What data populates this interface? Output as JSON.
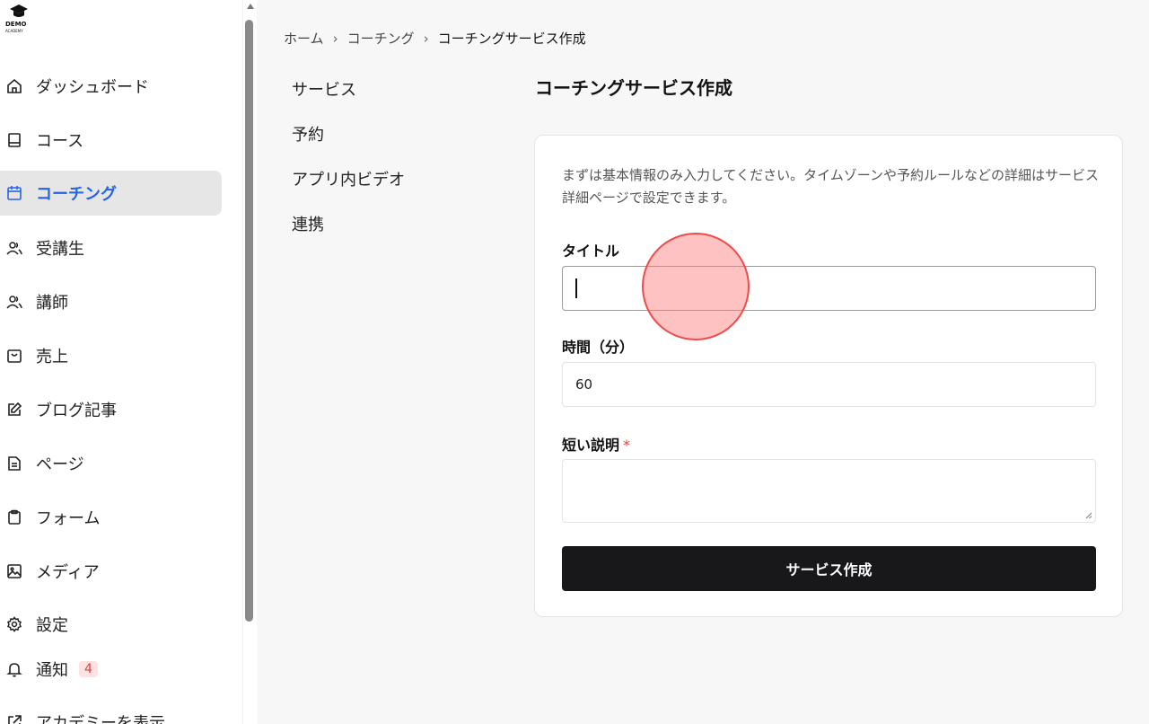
{
  "logo": {
    "text": "DEMO",
    "sub": "ACADEMY"
  },
  "sidebar": {
    "items": [
      {
        "label": "ダッシュボード",
        "icon": "home-icon"
      },
      {
        "label": "コース",
        "icon": "book-icon"
      },
      {
        "label": "コーチング",
        "icon": "calendar-icon",
        "active": true
      },
      {
        "label": "受講生",
        "icon": "users-icon"
      },
      {
        "label": "講師",
        "icon": "users-icon"
      },
      {
        "label": "売上",
        "icon": "bag-icon"
      },
      {
        "label": "ブログ記事",
        "icon": "edit-icon"
      },
      {
        "label": "ページ",
        "icon": "file-icon"
      },
      {
        "label": "フォーム",
        "icon": "clipboard-icon"
      },
      {
        "label": "メディア",
        "icon": "image-icon"
      },
      {
        "label": "設定",
        "icon": "gear-icon"
      },
      {
        "label": "通知",
        "icon": "bell-icon",
        "badge": "4"
      },
      {
        "label": "アカデミーを表示",
        "icon": "external-link-icon"
      }
    ]
  },
  "breadcrumb": [
    "ホーム",
    "コーチング",
    "コーチングサービス作成"
  ],
  "subnav": [
    "サービス",
    "予約",
    "アプリ内ビデオ",
    "連携"
  ],
  "page_title": "コーチングサービス作成",
  "form": {
    "intro": "まずは基本情報のみ入力してください。タイムゾーンや予約ルールなどの詳細はサービス詳細ページで設定できます。",
    "title_label": "タイトル",
    "title_value": "",
    "duration_label": "時間（分）",
    "duration_value": "60",
    "description_label": "短い説明",
    "required_mark": "*",
    "submit_label": "サービス作成"
  },
  "colors": {
    "accent": "#2563eb",
    "button": "#18181b",
    "required": "#e53e3e"
  }
}
